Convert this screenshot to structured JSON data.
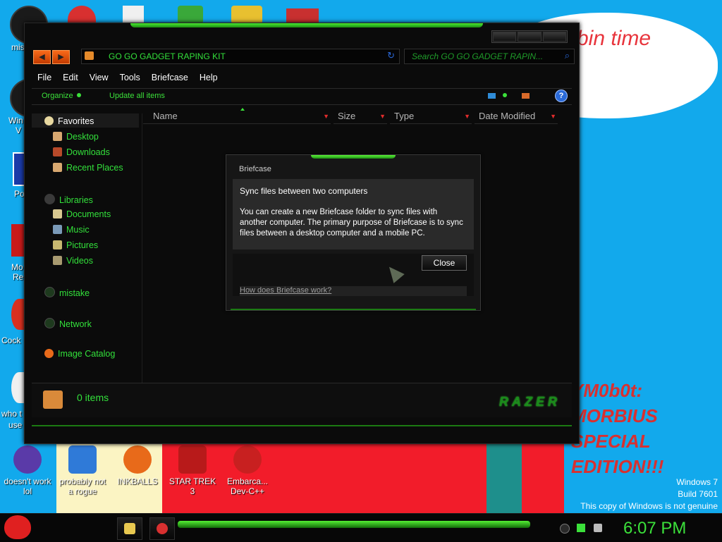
{
  "desktop": {
    "wallpaper_text": "bin  time",
    "wallpaper_caption_lines": [
      "YM0b0t:",
      "MORBIUS",
      "SPECIAL",
      "EDITION!!!"
    ],
    "left_icons": [
      {
        "label": "mis",
        "color": "#1a1a1a"
      },
      {
        "label": "Win",
        "sub": "V",
        "color": "#1a1a1a"
      },
      {
        "label": "Po",
        "color": "#1a3aa8"
      },
      {
        "label": "Mo",
        "sub": "Re",
        "color": "#c81a1a"
      },
      {
        "label": "Cock",
        "color": "#d83020"
      },
      {
        "label": "who t",
        "sub": "use",
        "color": "#f0f0f0"
      }
    ],
    "bottom_icons": [
      {
        "label": "doesn't work lol",
        "color": "#5a3aa8"
      },
      {
        "label": "probably not a rogue",
        "color": "#2f7ad8"
      },
      {
        "label": "INKBALLS",
        "color": "#e86a1a"
      },
      {
        "label": "STAR TREK 3",
        "color": "#b81a1a"
      },
      {
        "label": "Embarca... Dev-C++",
        "color": "#c82020"
      }
    ],
    "top_icons_colors": [
      "#1a1a1a",
      "#d83030",
      "#f0f0f0",
      "#3aa83a",
      "#e8c030",
      "#c83030"
    ],
    "genuine": {
      "line1": "Windows 7",
      "line2": "Build 7601",
      "line3": "This copy of Windows is not genuine"
    }
  },
  "explorer": {
    "nav": {
      "back": "◀",
      "forward": "▶"
    },
    "address": "GO GO GADGET RAPING KIT",
    "search_placeholder": "Search GO GO GADGET RAPIN...",
    "menu": [
      "File",
      "Edit",
      "View",
      "Tools",
      "Briefcase",
      "Help"
    ],
    "commands": {
      "organize": "Organize",
      "update_all": "Update all items"
    },
    "nav_pane": {
      "favorites": "Favorites",
      "favorite_items": [
        "Desktop",
        "Downloads",
        "Recent Places"
      ],
      "libraries": "Libraries",
      "library_items": [
        "Documents",
        "Music",
        "Pictures",
        "Videos"
      ],
      "mistake": "mistake",
      "network": "Network",
      "image_catalog": "Image Catalog"
    },
    "columns": [
      "Name",
      "Size",
      "Type",
      "Date Modified"
    ],
    "status": {
      "count": "0 items",
      "brand": "RAZER"
    }
  },
  "dialog": {
    "title": "Briefcase",
    "heading": "Sync files between two computers",
    "description": "You can create a new Briefcase folder to sync files with another computer. The primary purpose of Briefcase is to sync files between a desktop computer and a mobile PC.",
    "close_label": "Close",
    "help_link": "How does Briefcase work?"
  },
  "taskbar": {
    "clock": "6:07 PM"
  }
}
